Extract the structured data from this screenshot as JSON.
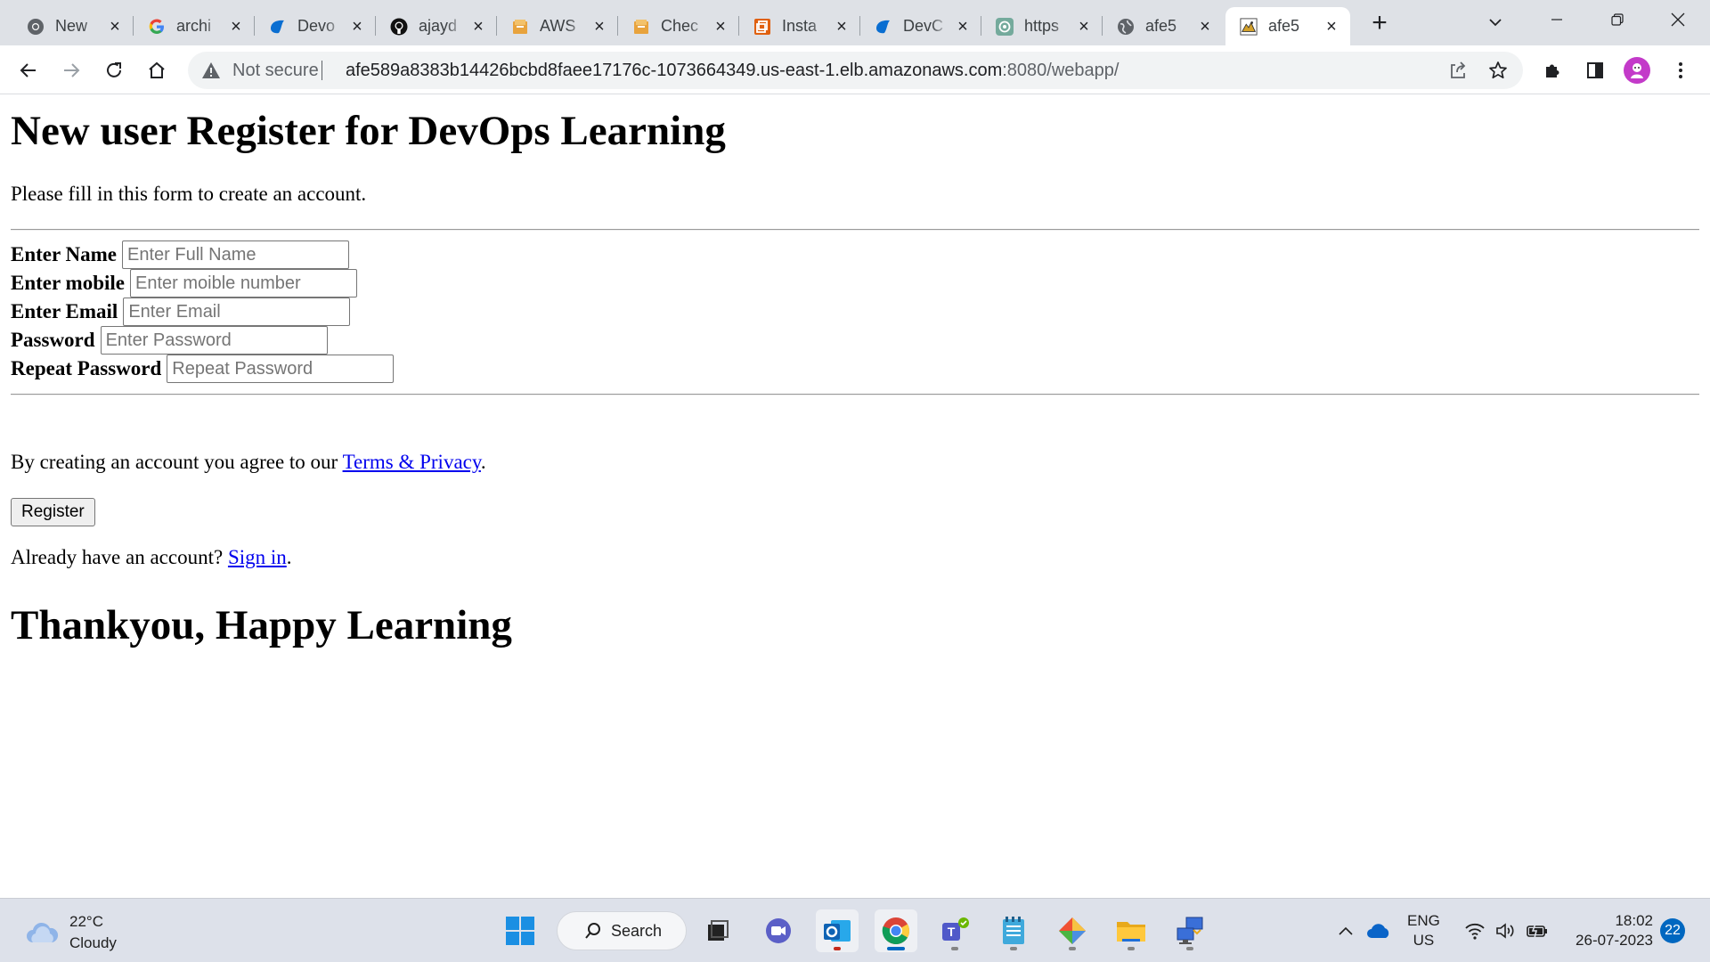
{
  "browser": {
    "tabs": [
      {
        "title": "New",
        "favicon": "chrome-icon",
        "active": false
      },
      {
        "title": "archi",
        "favicon": "google-icon",
        "active": false
      },
      {
        "title": "Devo",
        "favicon": "azure-devops-icon",
        "active": false
      },
      {
        "title": "ajayd",
        "favicon": "github-icon",
        "active": false
      },
      {
        "title": "AWS",
        "favicon": "aws-box-icon",
        "active": false
      },
      {
        "title": "Chec",
        "favicon": "aws-box-icon",
        "active": false
      },
      {
        "title": "Insta",
        "favicon": "aws-ec2-icon",
        "active": false
      },
      {
        "title": "DevC",
        "favicon": "azure-devops-icon",
        "active": false
      },
      {
        "title": "https",
        "favicon": "chatgpt-icon",
        "active": false
      },
      {
        "title": "afe5",
        "favicon": "globe-icon",
        "active": false
      },
      {
        "title": "afe5",
        "favicon": "tomcat-icon",
        "active": true
      }
    ],
    "toolbar": {
      "security_label": "Not secure",
      "url_host": "afe589a8383b14426bcbd8faee17176c-1073664349.us-east-1.elb.amazonaws.com",
      "url_path": ":8080/webapp/"
    }
  },
  "page": {
    "heading": "New user Register for DevOps Learning",
    "intro": "Please fill in this form to create an account.",
    "fields": [
      {
        "label": "Enter Name",
        "placeholder": "Enter Full Name",
        "value": ""
      },
      {
        "label": "Enter mobile",
        "placeholder": "Enter moible number",
        "value": ""
      },
      {
        "label": "Enter Email",
        "placeholder": "Enter Email",
        "value": ""
      },
      {
        "label": "Password",
        "placeholder": "Enter Password",
        "value": ""
      },
      {
        "label": "Repeat Password",
        "placeholder": "Repeat Password",
        "value": ""
      }
    ],
    "agree_text": "By creating an account you agree to our ",
    "terms_link": "Terms & Privacy",
    "agree_suffix": ".",
    "register_button": "Register",
    "signin_text": "Already have an account? ",
    "signin_link": "Sign in",
    "signin_suffix": ".",
    "footer_heading": "Thankyou, Happy Learning",
    "link_color": "#0000ee"
  },
  "taskbar": {
    "weather": {
      "temp": "22°C",
      "condition": "Cloudy"
    },
    "search_label": "Search",
    "apps": [
      "windows-start-icon",
      "task-view-icon",
      "meet-video-icon",
      "outlook-icon",
      "chrome-icon",
      "teams-icon",
      "notepad-icon",
      "git-icon",
      "file-explorer-icon",
      "remote-desktop-icon"
    ],
    "lang": {
      "line1": "ENG",
      "line2": "US"
    },
    "time": "18:02",
    "date": "26-07-2023",
    "notification_count": "22",
    "accent": "#0067c0"
  }
}
